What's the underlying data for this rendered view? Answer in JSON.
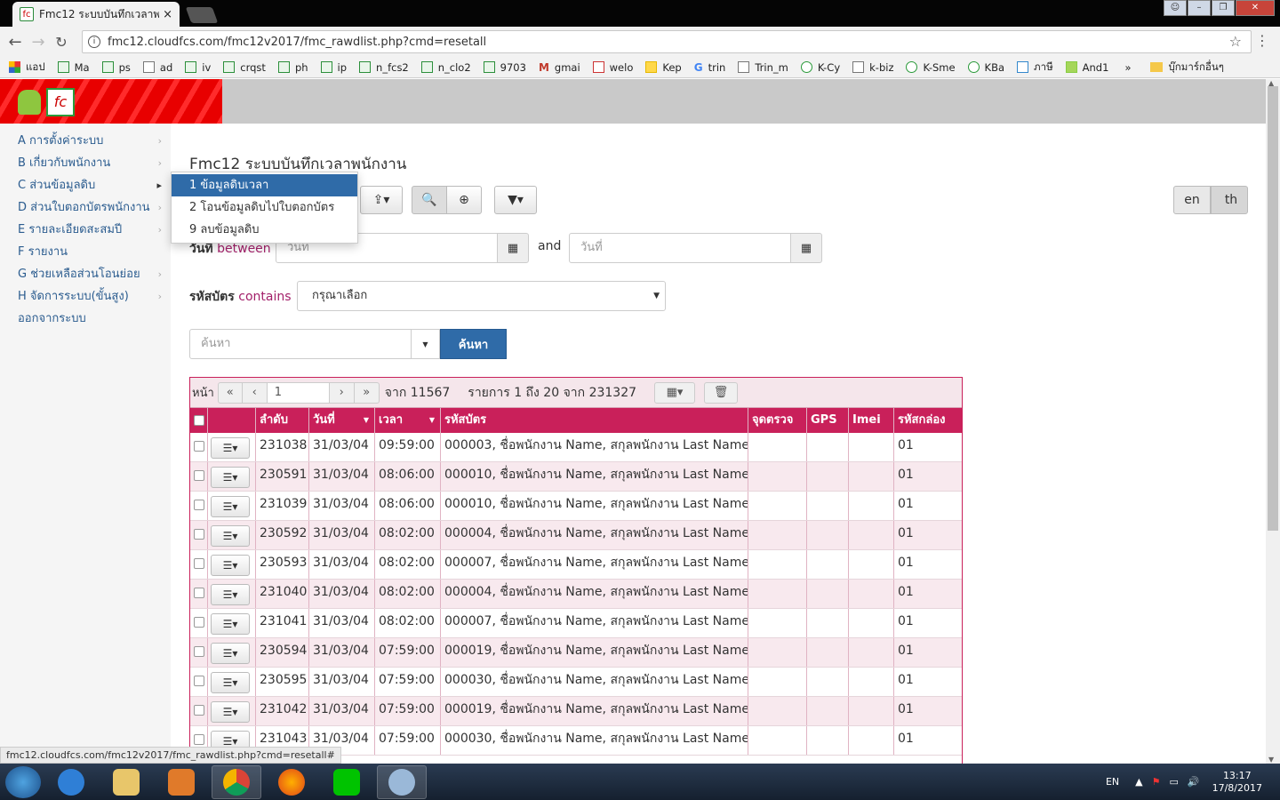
{
  "browser": {
    "tab_title": "Fmc12 ระบบบันทึกเวลาพนักงาน",
    "tab_close": "×",
    "url": "fmc12.cloudfcs.com/fmc12v2017/fmc_rawdlist.php?cmd=resetall",
    "bookmarks": [
      "แอป",
      "Ma",
      "ps",
      "ad",
      "iv",
      "crqst",
      "ph",
      "ip",
      "n_fcs2",
      "n_clo2",
      "9703",
      "gmai",
      "welo",
      "Kep",
      "trin",
      "Trin_m",
      "K-Cy",
      "k-biz",
      "K-Sme",
      "KBa",
      "ภาษี",
      "And1"
    ],
    "bookmarks_more": "»",
    "other_bookmarks": "บุ๊กมาร์กอื่นๆ",
    "status_url": "fmc12.cloudfcs.com/fmc12v2017/fmc_rawdlist.php?cmd=resetall#"
  },
  "sidebar": {
    "items": [
      {
        "label": "A การตั้งค่าระบบ",
        "caret": "›"
      },
      {
        "label": "B เกี่ยวกับพนักงาน",
        "caret": "›"
      },
      {
        "label": "C ส่วนข้อมูลดิบ",
        "caret": "▸"
      },
      {
        "label": "D ส่วนใบตอกบัตรพนักงาน",
        "caret": "›"
      },
      {
        "label": "E รายละเอียดสะสมปี",
        "caret": "›"
      },
      {
        "label": "F รายงาน",
        "caret": ""
      },
      {
        "label": "G ช่วยเหลือส่วนโอนย่อย",
        "caret": "›"
      },
      {
        "label": "H จัดการระบบ(ขั้นสูง)",
        "caret": "›"
      },
      {
        "label": "ออกจากระบบ",
        "caret": ""
      }
    ]
  },
  "submenu": {
    "items": [
      "1 ข้อมูลดิบเวลา",
      "2 โอนข้อมูลดิบไปใบตอกบัตร",
      "9 ลบข้อมูลดิบ"
    ]
  },
  "main": {
    "title": "Fmc12 ระบบบันทึกเวลาพนักงาน",
    "lang_en": "en",
    "lang_th": "th",
    "date_label": "วันที่",
    "date_op": "between",
    "date_from_placeholder": "วันที่",
    "and_label": "and",
    "date_to_placeholder": "วันที่",
    "card_label": "รหัสบัตร",
    "card_op": "contains",
    "card_select": "กรุณาเลือก",
    "search_placeholder": "ค้นหา",
    "search_button": "ค้นหา"
  },
  "pager": {
    "page_label": "หน้า",
    "page_value": "1",
    "of_pages": "จาก 11567",
    "records": "รายการ 1 ถึง 20 จาก 231327"
  },
  "table": {
    "columns": [
      "ลำดับ",
      "วันที่",
      "เวลา",
      "รหัสบัตร",
      "จุดตรวจ",
      "GPS",
      "Imei",
      "รหัสกล่อง"
    ],
    "rows": [
      {
        "id": "231038",
        "date": "31/03/04",
        "time": "09:59:00",
        "card": "000003, ชื่อพนักงาน Name, สกุลพนักงาน Last Name",
        "box": "01"
      },
      {
        "id": "230591",
        "date": "31/03/04",
        "time": "08:06:00",
        "card": "000010, ชื่อพนักงาน Name, สกุลพนักงาน Last Name",
        "box": "01"
      },
      {
        "id": "231039",
        "date": "31/03/04",
        "time": "08:06:00",
        "card": "000010, ชื่อพนักงาน Name, สกุลพนักงาน Last Name",
        "box": "01"
      },
      {
        "id": "230592",
        "date": "31/03/04",
        "time": "08:02:00",
        "card": "000004, ชื่อพนักงาน Name, สกุลพนักงาน Last Name",
        "box": "01"
      },
      {
        "id": "230593",
        "date": "31/03/04",
        "time": "08:02:00",
        "card": "000007, ชื่อพนักงาน Name, สกุลพนักงาน Last Name",
        "box": "01"
      },
      {
        "id": "231040",
        "date": "31/03/04",
        "time": "08:02:00",
        "card": "000004, ชื่อพนักงาน Name, สกุลพนักงาน Last Name",
        "box": "01"
      },
      {
        "id": "231041",
        "date": "31/03/04",
        "time": "08:02:00",
        "card": "000007, ชื่อพนักงาน Name, สกุลพนักงาน Last Name",
        "box": "01"
      },
      {
        "id": "230594",
        "date": "31/03/04",
        "time": "07:59:00",
        "card": "000019, ชื่อพนักงาน Name, สกุลพนักงาน Last Name",
        "box": "01"
      },
      {
        "id": "230595",
        "date": "31/03/04",
        "time": "07:59:00",
        "card": "000030, ชื่อพนักงาน Name, สกุลพนักงาน Last Name",
        "box": "01"
      },
      {
        "id": "231042",
        "date": "31/03/04",
        "time": "07:59:00",
        "card": "000019, ชื่อพนักงาน Name, สกุลพนักงาน Last Name",
        "box": "01"
      },
      {
        "id": "231043",
        "date": "31/03/04",
        "time": "07:59:00",
        "card": "000030, ชื่อพนักงาน Name, สกุลพนักงาน Last Name",
        "box": "01"
      }
    ]
  },
  "taskbar": {
    "lang": "EN",
    "time": "13:17",
    "date": "17/8/2017"
  },
  "colors": {
    "brand_red": "#e80000",
    "grid_header": "#c9205a",
    "primary_button": "#2f6ba8"
  }
}
